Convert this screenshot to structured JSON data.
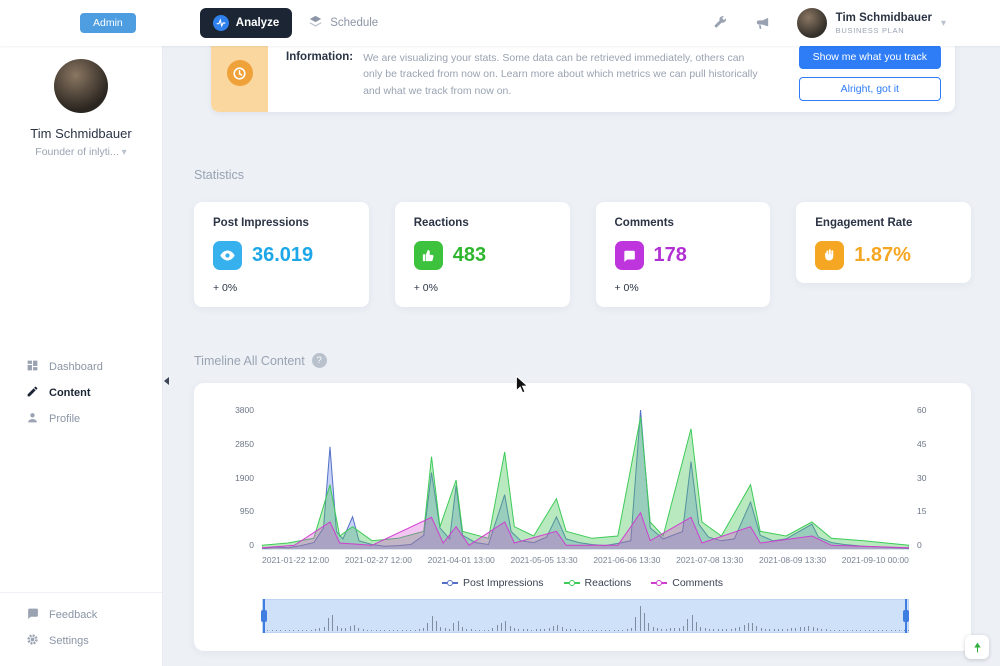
{
  "header": {
    "admin_button": "Admin",
    "tabs": [
      {
        "label": "Analyze",
        "active": true
      },
      {
        "label": "Schedule",
        "active": false
      }
    ],
    "user_name": "Tim Schmidbauer",
    "user_plan": "BUSINESS PLAN"
  },
  "sidebar": {
    "user_name": "Tim Schmidbauer",
    "user_subtitle": "Founder of inlyti...",
    "nav": [
      {
        "label": "Dashboard",
        "active": false
      },
      {
        "label": "Content",
        "active": true
      },
      {
        "label": "Profile",
        "active": false
      }
    ],
    "footer_nav": [
      {
        "label": "Feedback"
      },
      {
        "label": "Settings"
      }
    ]
  },
  "banner": {
    "label": "Information:",
    "text": "We are visualizing your stats. Some data can be retrieved immediately, others can only be tracked from now on. Learn more about which metrics we can pull historically and what we track from now on.",
    "primary_button": "Show me what you track",
    "secondary_button": "Alright, got it"
  },
  "statistics": {
    "section_title": "Statistics",
    "cards": [
      {
        "label": "Post Impressions",
        "value": "36.019",
        "delta": "+ 0%",
        "icon": "eye-icon",
        "icon_color": "#36b1ee",
        "value_color": "#1da7e8"
      },
      {
        "label": "Reactions",
        "value": "483",
        "delta": "+ 0%",
        "icon": "thumbs-up-icon",
        "icon_color": "#3cc23c",
        "value_color": "#2fb52f"
      },
      {
        "label": "Comments",
        "value": "178",
        "delta": "+ 0%",
        "icon": "comment-icon",
        "icon_color": "#bf35dd",
        "value_color": "#b22fd4"
      },
      {
        "label": "Engagement Rate",
        "value": "1.87%",
        "delta": "",
        "icon": "clap-icon",
        "icon_color": "#f5a623",
        "value_color": "#f5a623"
      }
    ]
  },
  "timeline": {
    "section_title": "Timeline All Content",
    "help_label": "?",
    "chart_data": {
      "type": "line",
      "x_labels": [
        "2021-01-22 12:00",
        "2021-02-27 12:00",
        "2021-04-01 13:00",
        "2021-05-05 13:30",
        "2021-06-06 13:30",
        "2021-07-08 13:30",
        "2021-08-09 13:30",
        "2021-09-10 00:00"
      ],
      "left_axis": {
        "ticks": [
          0,
          950,
          1900,
          2850,
          3800
        ],
        "max": 3800
      },
      "right_axis": {
        "ticks": [
          0,
          15,
          30,
          45,
          60
        ],
        "max": 60
      },
      "legend": [
        {
          "name": "Post Impressions",
          "color": "#5470c6"
        },
        {
          "name": "Reactions",
          "color": "#3ecb59"
        },
        {
          "name": "Comments",
          "color": "#cf3fcf"
        }
      ],
      "series": [
        {
          "name": "Post Impressions",
          "axis": "left",
          "color": "#5470c6",
          "fill": "rgba(96,130,235,0.35)",
          "points": [
            [
              0,
              30
            ],
            [
              0.02,
              80
            ],
            [
              0.04,
              60
            ],
            [
              0.06,
              120
            ],
            [
              0.08,
              200
            ],
            [
              0.095,
              600
            ],
            [
              0.105,
              2800
            ],
            [
              0.115,
              500
            ],
            [
              0.125,
              300
            ],
            [
              0.14,
              900
            ],
            [
              0.15,
              250
            ],
            [
              0.17,
              150
            ],
            [
              0.19,
              100
            ],
            [
              0.21,
              120
            ],
            [
              0.23,
              150
            ],
            [
              0.25,
              400
            ],
            [
              0.262,
              2100
            ],
            [
              0.275,
              600
            ],
            [
              0.29,
              300
            ],
            [
              0.3,
              1750
            ],
            [
              0.31,
              400
            ],
            [
              0.33,
              200
            ],
            [
              0.35,
              150
            ],
            [
              0.375,
              1500
            ],
            [
              0.385,
              500
            ],
            [
              0.4,
              250
            ],
            [
              0.42,
              200
            ],
            [
              0.44,
              350
            ],
            [
              0.455,
              900
            ],
            [
              0.47,
              300
            ],
            [
              0.49,
              200
            ],
            [
              0.51,
              150
            ],
            [
              0.53,
              120
            ],
            [
              0.55,
              180
            ],
            [
              0.57,
              250
            ],
            [
              0.585,
              3800
            ],
            [
              0.6,
              600
            ],
            [
              0.62,
              300
            ],
            [
              0.65,
              500
            ],
            [
              0.663,
              2400
            ],
            [
              0.675,
              700
            ],
            [
              0.69,
              350
            ],
            [
              0.71,
              250
            ],
            [
              0.73,
              300
            ],
            [
              0.755,
              1300
            ],
            [
              0.77,
              400
            ],
            [
              0.79,
              250
            ],
            [
              0.81,
              300
            ],
            [
              0.85,
              700
            ],
            [
              0.86,
              350
            ],
            [
              0.88,
              200
            ],
            [
              0.9,
              150
            ],
            [
              0.93,
              100
            ],
            [
              0.96,
              80
            ],
            [
              1,
              40
            ]
          ]
        },
        {
          "name": "Reactions",
          "axis": "right",
          "color": "#3ecb59",
          "fill": "rgba(80,200,96,0.4)",
          "points": [
            [
              0,
              2
            ],
            [
              0.04,
              3
            ],
            [
              0.08,
              5
            ],
            [
              0.105,
              28
            ],
            [
              0.12,
              6
            ],
            [
              0.14,
              10
            ],
            [
              0.17,
              4
            ],
            [
              0.21,
              5
            ],
            [
              0.25,
              8
            ],
            [
              0.262,
              40
            ],
            [
              0.275,
              10
            ],
            [
              0.3,
              30
            ],
            [
              0.31,
              8
            ],
            [
              0.35,
              5
            ],
            [
              0.375,
              42
            ],
            [
              0.39,
              10
            ],
            [
              0.42,
              6
            ],
            [
              0.455,
              22
            ],
            [
              0.47,
              8
            ],
            [
              0.51,
              5
            ],
            [
              0.55,
              6
            ],
            [
              0.585,
              57
            ],
            [
              0.6,
              12
            ],
            [
              0.62,
              6
            ],
            [
              0.663,
              52
            ],
            [
              0.68,
              12
            ],
            [
              0.71,
              6
            ],
            [
              0.755,
              28
            ],
            [
              0.77,
              8
            ],
            [
              0.81,
              6
            ],
            [
              0.85,
              12
            ],
            [
              0.88,
              5
            ],
            [
              0.93,
              4
            ],
            [
              1,
              2
            ]
          ]
        },
        {
          "name": "Comments",
          "axis": "right",
          "color": "#cf3fcf",
          "fill": "rgba(214,62,214,0.3)",
          "points": [
            [
              0,
              1
            ],
            [
              0.05,
              2
            ],
            [
              0.105,
              12
            ],
            [
              0.12,
              3
            ],
            [
              0.17,
              2
            ],
            [
              0.262,
              14
            ],
            [
              0.28,
              3
            ],
            [
              0.3,
              10
            ],
            [
              0.32,
              2
            ],
            [
              0.375,
              12
            ],
            [
              0.39,
              3
            ],
            [
              0.455,
              8
            ],
            [
              0.47,
              2
            ],
            [
              0.55,
              2
            ],
            [
              0.585,
              16
            ],
            [
              0.6,
              4
            ],
            [
              0.663,
              14
            ],
            [
              0.68,
              3
            ],
            [
              0.755,
              10
            ],
            [
              0.77,
              3
            ],
            [
              0.85,
              6
            ],
            [
              0.88,
              2
            ],
            [
              1,
              1
            ]
          ]
        }
      ]
    }
  },
  "icons": {
    "header": [
      "pulse-circle-icon",
      "layers-icon",
      "wrench-icon",
      "megaphone-icon",
      "chevron-down-icon"
    ],
    "sidebar": [
      "dashboard-grid-icon",
      "pencil-icon",
      "person-icon",
      "speech-bubble-icon",
      "gear-icon"
    ],
    "banner": [
      "clock-icon"
    ],
    "misc": [
      "help-question-icon",
      "growth-arrow-icon",
      "mouse-cursor"
    ]
  },
  "colors": {
    "accent_blue": "#2e7cf6",
    "active_tab_bg": "#1b2534",
    "banner_orange": "#f0a23a",
    "navigator_bg": "#cfe1f8"
  }
}
